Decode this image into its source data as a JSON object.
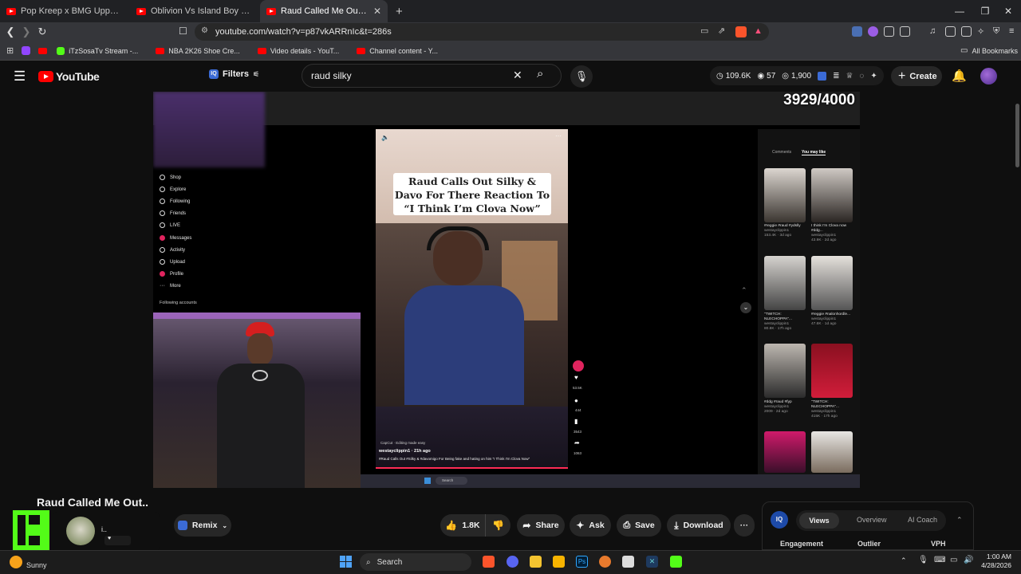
{
  "tabs": [
    {
      "title": "Pop Kreep x BMG UpperClass | Drill M",
      "active": false
    },
    {
      "title": "Oblivion Vs Island Boy Red Full Fi",
      "active": false
    },
    {
      "title": "Raud Called Me Out.. - YouTu",
      "active": true
    }
  ],
  "address": {
    "url": "youtube.com/watch?v=p87vkARRnIc&t=286s"
  },
  "bookmarks": [
    {
      "label": "iTzSosaTv Stream -...",
      "icon": "kick-icon"
    },
    {
      "label": "NBA 2K26 Shoe Cre...",
      "icon": "youtube-icon"
    },
    {
      "label": "Video details - YouT...",
      "icon": "youtube-icon"
    },
    {
      "label": "Channel content - Y...",
      "icon": "youtube-icon"
    }
  ],
  "all_bookmarks": "All Bookmarks",
  "youtube": {
    "brand": "YouTube",
    "filters": "Filters",
    "search_value": "raud silky",
    "stats": {
      "views": "109.6K",
      "viewers": "57",
      "subs": "1,900"
    },
    "create": "Create"
  },
  "video": {
    "counter": "3929/4000",
    "sidebar": [
      "Shop",
      "Explore",
      "Following",
      "Friends",
      "LIVE",
      "Messages",
      "Activity",
      "Upload",
      "Profile",
      "More"
    ],
    "following_accounts": "Following accounts",
    "phone_title": "Raud Calls Out Silky & Davo For There Reaction To “I Think I’m Clova Now”",
    "phone_user": "westayclippin1 · 21h ago",
    "phone_caption": "#Raud Calls Out #Silky & #davomigo For Being fake and hating on him “I Think I'm Clova Now”",
    "capcut": "CapCut · Editing made easy",
    "side_counts": [
      "53.5K",
      "444",
      "3543",
      "1063"
    ],
    "right_tabs": [
      "Comments",
      "You may like"
    ],
    "inner_search": "Search",
    "recs": [
      {
        "title": "#reggie #raud #ydslly",
        "user": "westayclippin1",
        "meta": "153.4K · 3d ago"
      },
      {
        "title": "I think I'm Clova now #ddg...",
        "user": "westayclippin1",
        "meta": "43.9K · 2d ago"
      },
      {
        "title": "\"TWITCH: NLECHOPPA\"...",
        "user": "westayclippin1",
        "meta": "80.8K · 17h ago"
      },
      {
        "title": "#reggie #nalonhordle...",
        "user": "westayclippin1",
        "meta": "47.6K · 1d ago"
      },
      {
        "title": "#ddg #raud #fyp",
        "user": "westayclippin1",
        "meta": "2009 · 2d ago"
      },
      {
        "title": "\"TWITCH: NLECHOPPA\"...",
        "user": "westayclippin1",
        "meta": "415K · 17h ago"
      }
    ]
  },
  "watch": {
    "title": "Raud Called Me Out..",
    "channel_initial": "i..",
    "remix": "Remix",
    "likes": "1.8K",
    "share": "Share",
    "ask": "Ask",
    "save": "Save",
    "download": "Download"
  },
  "analytics": {
    "tabs": [
      "Views",
      "Overview",
      "AI Coach"
    ],
    "cols": [
      "Engagement",
      "Outlier",
      "VPH"
    ]
  },
  "taskbar": {
    "weather": "Sunny",
    "search": "Search",
    "time": "1:00 AM",
    "date": "4/28/2026"
  },
  "colors": {
    "youtube_red": "#ff0000",
    "kick_green": "#53fc18",
    "accent_blue": "#3ea6ff"
  }
}
